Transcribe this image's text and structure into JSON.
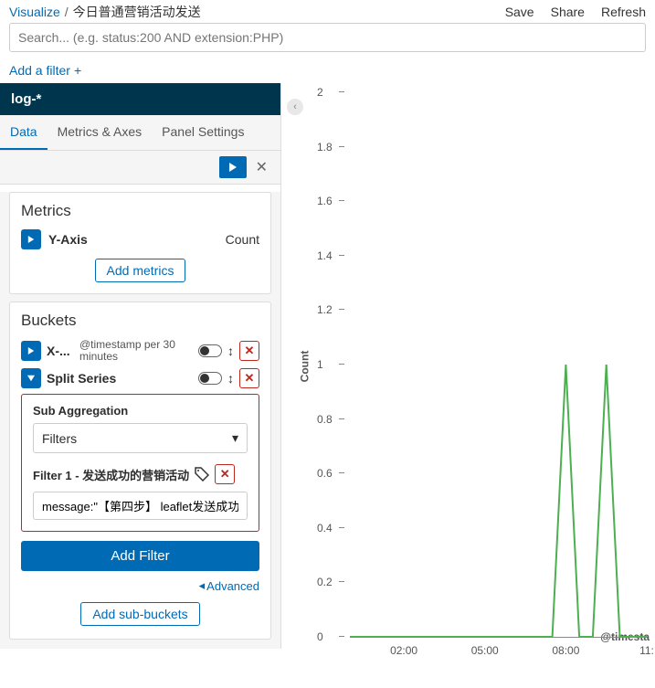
{
  "breadcrumb": {
    "root": "Visualize",
    "sep": "/",
    "current": "今日普通营销活动发送"
  },
  "top_actions": {
    "save": "Save",
    "share": "Share",
    "refresh": "Refresh"
  },
  "search": {
    "placeholder": "Search... (e.g. status:200 AND extension:PHP)"
  },
  "add_filter": "Add a filter",
  "index_pattern": "log-*",
  "tabs": {
    "data": "Data",
    "axes": "Metrics & Axes",
    "panel": "Panel Settings"
  },
  "metrics": {
    "title": "Metrics",
    "yaxis_label": "Y-Axis",
    "yaxis_value": "Count",
    "add_btn": "Add metrics"
  },
  "buckets": {
    "title": "Buckets",
    "xaxis_label": "X-...",
    "xaxis_desc": "@timestamp per 30 minutes",
    "split_label": "Split Series",
    "subagg_label": "Sub Aggregation",
    "subagg_value": "Filters",
    "filter1_label": "Filter 1 - 发送成功的营销活动",
    "filter1_value": "message:\"【第四步】 leaflet发送成功\"",
    "add_filter_btn": "Add Filter",
    "advanced": "Advanced",
    "add_sub_btn": "Add sub-buckets"
  },
  "chart_data": {
    "type": "line",
    "ylabel": "Count",
    "xlabel": "@timesta",
    "ylim": [
      0,
      2
    ],
    "yticks": [
      0,
      0.2,
      0.4,
      0.6,
      0.8,
      1,
      1.2,
      1.4,
      1.6,
      1.8,
      2
    ],
    "x_categories": [
      "02:00",
      "05:00",
      "08:00",
      "11:"
    ],
    "series": [
      {
        "name": "发送成功的营销活动",
        "x": [
          "00:00",
          "00:30",
          "01:00",
          "01:30",
          "02:00",
          "02:30",
          "03:00",
          "03:30",
          "04:00",
          "04:30",
          "05:00",
          "05:30",
          "06:00",
          "06:30",
          "07:00",
          "07:30",
          "08:00",
          "08:30",
          "09:00",
          "09:30",
          "10:00",
          "10:30",
          "11:00"
        ],
        "y": [
          0,
          0,
          0,
          0,
          0,
          0,
          0,
          0,
          0,
          0,
          0,
          0,
          0,
          0,
          0,
          0,
          1,
          0,
          0,
          1,
          0,
          0,
          0
        ]
      }
    ]
  }
}
